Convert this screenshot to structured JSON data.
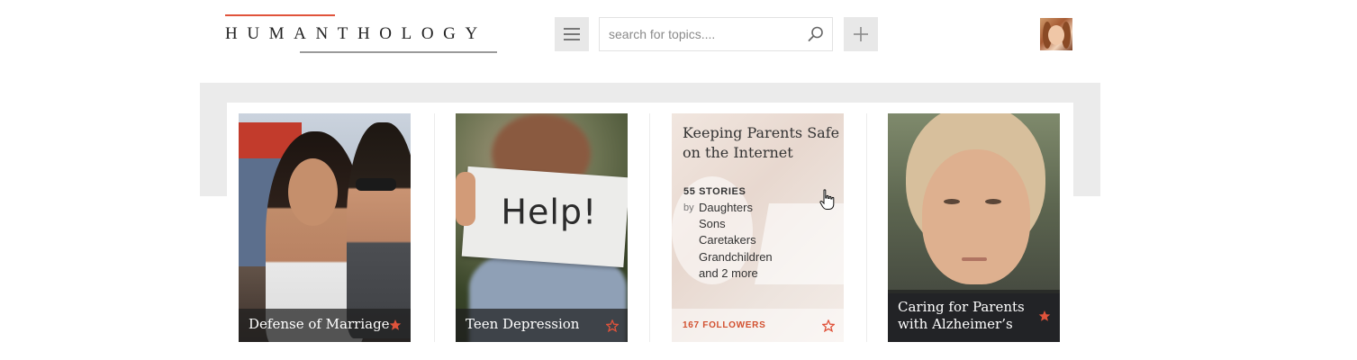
{
  "header": {
    "logo_text": "HUMANTHOLOGY",
    "menu_icon": "hamburger-icon",
    "search": {
      "placeholder": "search for topics....",
      "value": "",
      "icon": "search-icon"
    },
    "add_icon": "plus-icon",
    "avatar_icon": "user-avatar"
  },
  "colors": {
    "accent": "#e0533b",
    "panel_bg": "#ebebeb",
    "followers": "#d2502f"
  },
  "cards": [
    {
      "title": "Defense of Marriage",
      "starred": true,
      "star_icon": "star-filled-icon"
    },
    {
      "title": "Teen Depression",
      "starred": false,
      "star_icon": "star-outline-icon",
      "image_text": "Help!"
    },
    {
      "title": "Keeping Parents Safe on the Internet",
      "stories": "55 STORIES",
      "by": "by",
      "authors": [
        "Daughters",
        "Sons",
        "Caretakers",
        "Grandchildren",
        "and 2 more"
      ],
      "followers": "167 FOLLOWERS",
      "starred": false,
      "star_icon": "star-outline-icon"
    },
    {
      "title": "Caring for Parents with Alzheimer’s",
      "starred": true,
      "star_icon": "star-filled-icon"
    }
  ]
}
